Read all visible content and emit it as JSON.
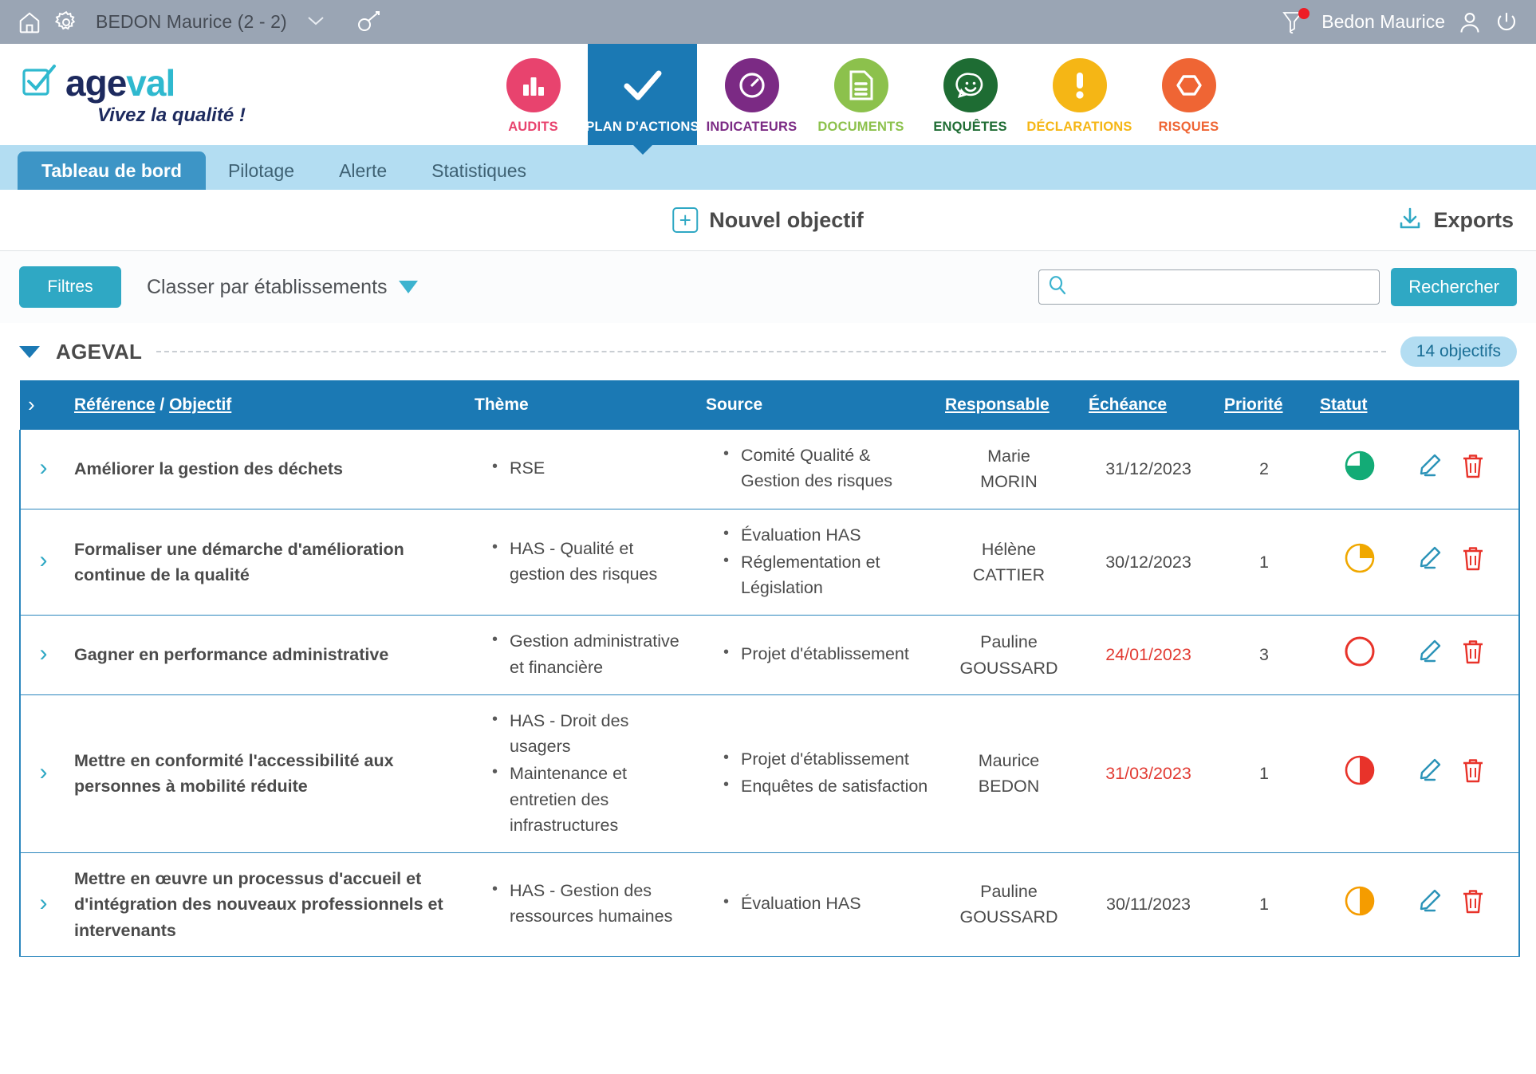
{
  "topbar": {
    "home_icon": "home-icon",
    "settings_icon": "gear-icon",
    "establishment": "BEDON Maurice (2 - 2)",
    "chevron_icon": "chevron-down-icon",
    "key_icon": "key-icon",
    "notifications_icon": "bell-icon",
    "user_name": "Bedon Maurice",
    "profile_icon": "user-icon",
    "logout_icon": "power-icon"
  },
  "brand": {
    "logo_check_icon": "checkbox-check-icon",
    "name_part1": "a",
    "name_part2": "ge",
    "name_part3": "v",
    "name_part4": "al",
    "tagline": "Vivez la qualité !"
  },
  "modules": [
    {
      "label": "AUDITS",
      "icon": "bar-chart-icon",
      "color": "#e8436e",
      "active": false
    },
    {
      "label": "PLAN D'ACTIONS",
      "icon": "check-icon",
      "color": "#1b79b4",
      "active": true
    },
    {
      "label": "INDICATEURS",
      "icon": "gauge-icon",
      "color": "#7b2a84",
      "active": false
    },
    {
      "label": "DOCUMENTS",
      "icon": "document-icon",
      "color": "#8cc14c",
      "active": false
    },
    {
      "label": "ENQUÊTES",
      "icon": "smiley-chat-icon",
      "color": "#1e6c33",
      "active": false
    },
    {
      "label": "DÉCLARATIONS",
      "icon": "exclamation-icon",
      "color": "#f5b615",
      "active": false
    },
    {
      "label": "RISQUES",
      "icon": "hexagon-icon",
      "color": "#ef6534",
      "active": false
    }
  ],
  "subtabs": [
    {
      "label": "Tableau de bord",
      "active": true
    },
    {
      "label": "Pilotage",
      "active": false
    },
    {
      "label": "Alerte",
      "active": false
    },
    {
      "label": "Statistiques",
      "active": false
    }
  ],
  "actionbar": {
    "new_objective_label": "Nouvel objectif",
    "new_objective_icon": "plus-box-icon",
    "exports_label": "Exports",
    "exports_icon": "download-icon"
  },
  "filters": {
    "filtres_label": "Filtres",
    "classer_label": "Classer par établissements",
    "classer_icon": "triangle-down-icon",
    "search_icon": "search-icon",
    "search_value": "",
    "search_placeholder": "",
    "search_button_label": "Rechercher"
  },
  "group": {
    "toggle_icon": "triangle-down-icon",
    "name": "AGEVAL",
    "count_label": "14 objectifs"
  },
  "table": {
    "columns": {
      "expand": "",
      "reference": "Référence",
      "separator": "/",
      "objectif": "Objectif",
      "theme": "Thème",
      "source": "Source",
      "responsable": "Responsable",
      "echeance": "Échéance",
      "priorite": "Priorité",
      "statut": "Statut"
    },
    "row_expand_icon": "chevron-right-icon",
    "edit_icon": "pencil-icon",
    "delete_icon": "trash-icon",
    "rows": [
      {
        "objectif": "Améliorer la gestion des déchets",
        "theme": [
          "RSE"
        ],
        "source": [
          "Comité Qualité & Gestion des risques"
        ],
        "responsable_first": "Marie",
        "responsable_last": "MORIN",
        "echeance": "31/12/2023",
        "echeance_late": false,
        "priorite": "2",
        "statut_color": "#13ab76",
        "statut_percent": 75
      },
      {
        "objectif": "Formaliser une démarche d'amélioration continue de la qualité",
        "theme": [
          "HAS - Qualité et gestion des risques"
        ],
        "source": [
          "Évaluation HAS",
          "Réglementation et Législation"
        ],
        "responsable_first": "Hélène",
        "responsable_last": "CATTIER",
        "echeance": "30/12/2023",
        "echeance_late": false,
        "priorite": "1",
        "statut_color": "#f0a800",
        "statut_percent": 25
      },
      {
        "objectif": "Gagner en performance administrative",
        "theme": [
          "Gestion administrative et financière"
        ],
        "source": [
          "Projet d'établissement"
        ],
        "responsable_first": "Pauline",
        "responsable_last": "GOUSSARD",
        "echeance": "24/01/2023",
        "echeance_late": true,
        "priorite": "3",
        "statut_color": "#e8332a",
        "statut_percent": 0
      },
      {
        "objectif": "Mettre en conformité l'accessibilité aux personnes à mobilité réduite",
        "theme": [
          "HAS - Droit des usagers",
          "Maintenance et entretien des infrastructures"
        ],
        "source": [
          "Projet d'établissement",
          "Enquêtes de satisfaction"
        ],
        "responsable_first": "Maurice",
        "responsable_last": "BEDON",
        "echeance": "31/03/2023",
        "echeance_late": true,
        "priorite": "1",
        "statut_color": "#e8332a",
        "statut_percent": 50
      },
      {
        "objectif": "Mettre en œuvre un processus d'accueil et d'intégration des nouveaux professionnels et intervenants",
        "theme": [
          "HAS - Gestion des ressources humaines"
        ],
        "source": [
          "Évaluation HAS"
        ],
        "responsable_first": "Pauline",
        "responsable_last": "GOUSSARD",
        "echeance": "30/11/2023",
        "echeance_late": false,
        "priorite": "1",
        "statut_color": "#f59c00",
        "statut_percent": 50
      }
    ]
  },
  "colors": {
    "primary_blue": "#1b79b4",
    "teal": "#2fa8c4",
    "light_blue": "#b3ddf2",
    "topbar_grey": "#9aa5b4",
    "red": "#e8332a"
  }
}
